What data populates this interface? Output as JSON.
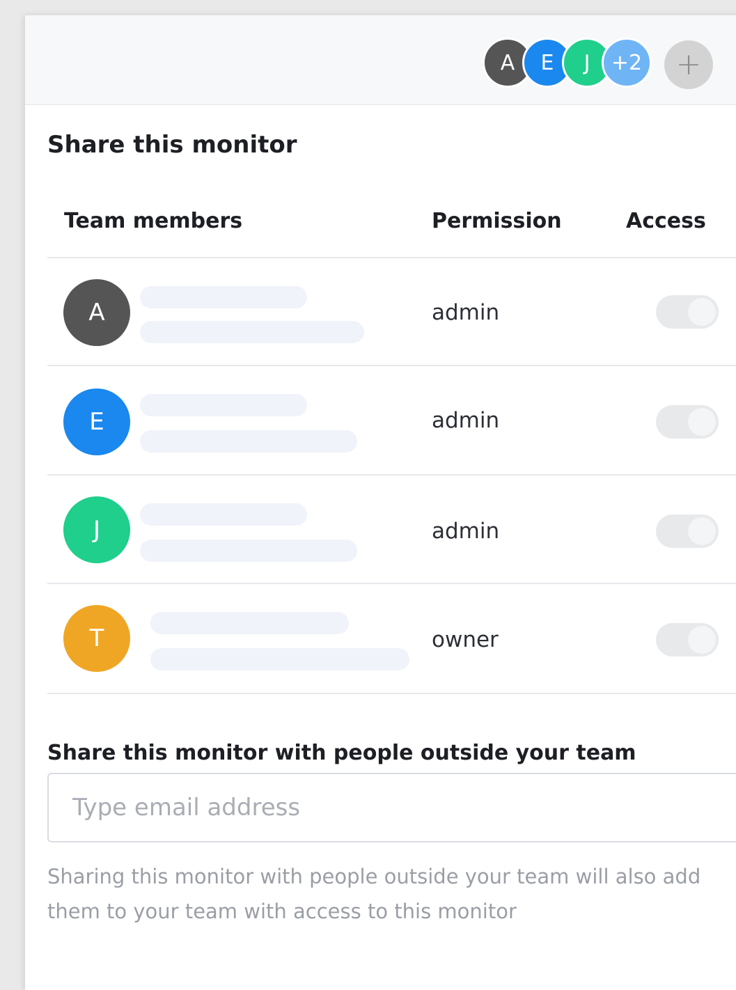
{
  "header": {
    "avatars": [
      {
        "initial": "A",
        "color": "#555555"
      },
      {
        "initial": "E",
        "color": "#1a88ee"
      },
      {
        "initial": "J",
        "color": "#1fcf8b"
      },
      {
        "initial": "+2",
        "color": "#6fb4f5"
      }
    ],
    "add_label": "+"
  },
  "title": "Share this monitor",
  "table": {
    "headers": {
      "members": "Team members",
      "permission": "Permission",
      "access": "Access"
    },
    "rows": [
      {
        "initial": "A",
        "color": "#555555",
        "permission": "admin",
        "access": false
      },
      {
        "initial": "E",
        "color": "#1a88ee",
        "permission": "admin",
        "access": false
      },
      {
        "initial": "J",
        "color": "#1fcf8b",
        "permission": "admin",
        "access": false
      },
      {
        "initial": "T",
        "color": "#f0a625",
        "permission": "owner",
        "access": false
      }
    ]
  },
  "external": {
    "title": "Share this monitor with people outside your team",
    "placeholder": "Type email address",
    "help": "Sharing this monitor with people outside your team will also add them to your team with access to this monitor"
  }
}
